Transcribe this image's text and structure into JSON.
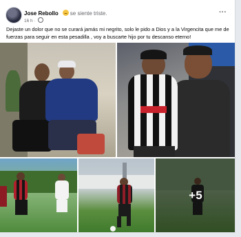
{
  "post": {
    "author": "Jose Rebollo",
    "feeling": "se siente triste.",
    "time": "16 h",
    "text": "Dejaste un dolor que no se curará jamás mi negrito, solo le pido a Dios y a la Virgencita que me de fuerzas para seguir en esta pesadilla , voy a buscarte hijo  por tu descanso eterno!",
    "more_icon": "···"
  },
  "gallery": {
    "more_count": "+5"
  },
  "colors": {
    "name": "#050505",
    "secondary_text": "#65676b"
  }
}
